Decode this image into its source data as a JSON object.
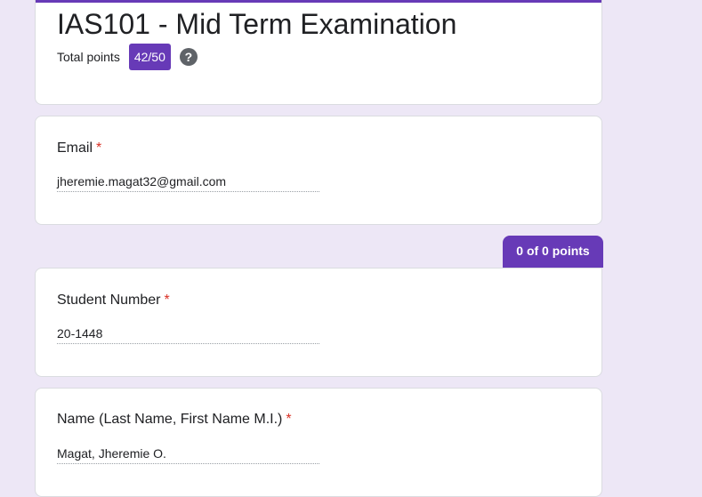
{
  "form": {
    "title": "IAS101 - Mid Term Examination",
    "total_points_label": "Total points",
    "total_points_value": "42/50",
    "help_icon": "question-mark-circle-icon"
  },
  "questions": [
    {
      "label": "Email",
      "required": "*",
      "answer": "jheremie.magat32@gmail.com"
    },
    {
      "label": "Student Number",
      "required": "*",
      "answer": "20-1448"
    },
    {
      "label": "Name (Last Name, First Name M.I.)",
      "required": "*",
      "answer": "Magat, Jheremie O."
    }
  ],
  "section": {
    "points_label": "0 of 0 points"
  },
  "colors": {
    "accent": "#673ab7",
    "background": "#ede7f6",
    "required": "#d93025"
  }
}
